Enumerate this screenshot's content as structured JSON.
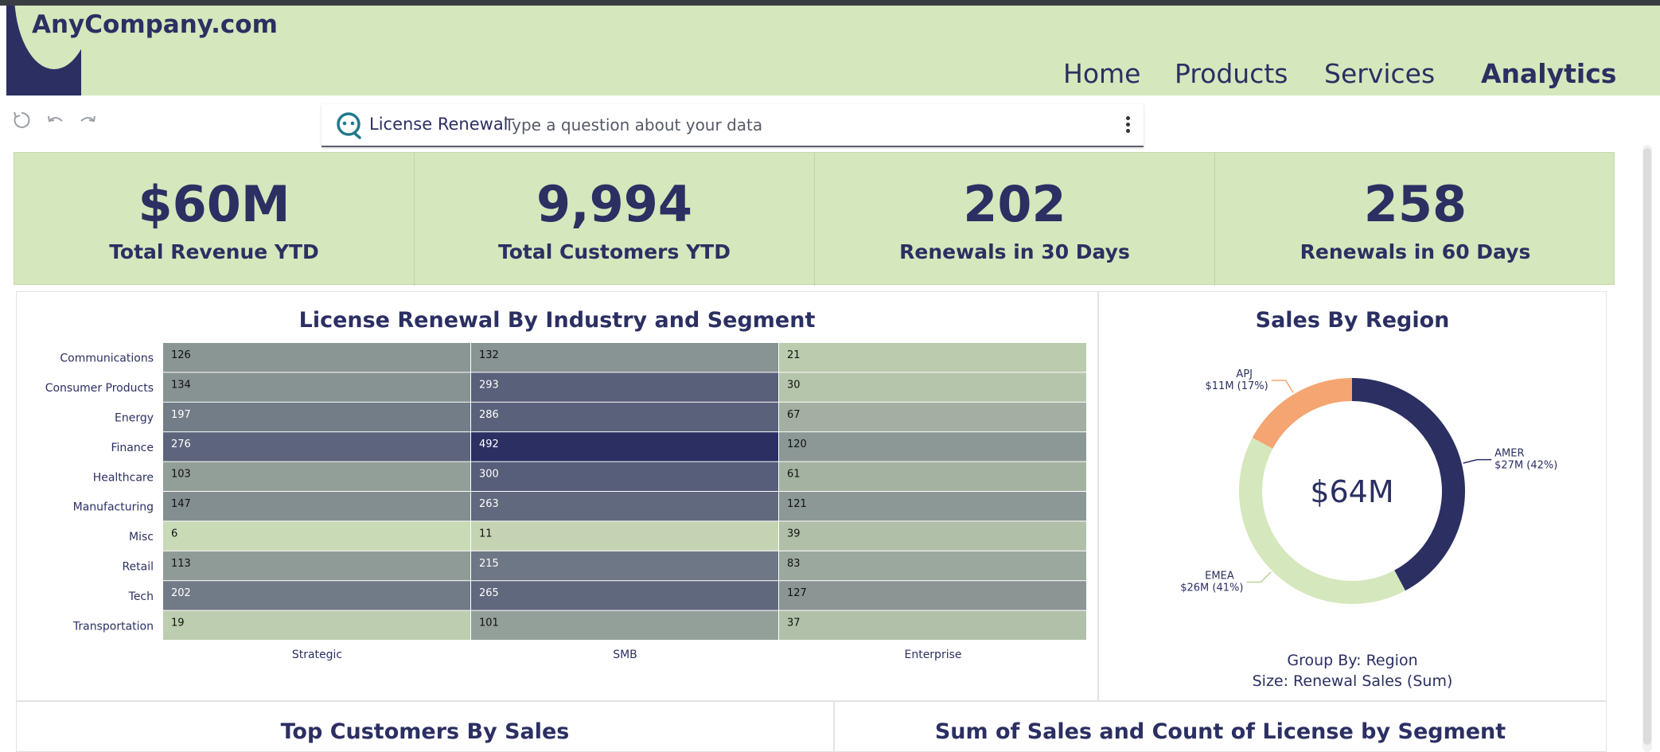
{
  "brand": {
    "logo_text": "AnyCompany.com"
  },
  "nav": {
    "items": [
      "Home",
      "Products",
      "Services",
      "Analytics"
    ],
    "active": "Analytics"
  },
  "toolbar": {
    "reset_icon": "reset-icon",
    "undo_icon": "undo-icon",
    "redo_icon": "redo-icon"
  },
  "qbar": {
    "topic": "License Renewal",
    "placeholder": "Type a question about your data"
  },
  "kpis": [
    {
      "value": "$60M",
      "label": "Total Revenue YTD"
    },
    {
      "value": "9,994",
      "label": "Total Customers YTD"
    },
    {
      "value": "202",
      "label": "Renewals in 30 Days"
    },
    {
      "value": "258",
      "label": "Renewals in 60 Days"
    }
  ],
  "heatmap": {
    "title": "License Renewal By Industry and Segment",
    "chart_data": {
      "type": "heatmap",
      "rows": [
        "Communications",
        "Consumer Products",
        "Energy",
        "Finance",
        "Healthcare",
        "Manufacturing",
        "Misc",
        "Retail",
        "Tech",
        "Transportation"
      ],
      "columns": [
        "Strategic",
        "SMB",
        "Enterprise"
      ],
      "values": [
        [
          126,
          132,
          21
        ],
        [
          134,
          293,
          30
        ],
        [
          197,
          286,
          67
        ],
        [
          276,
          492,
          120
        ],
        [
          103,
          300,
          61
        ],
        [
          147,
          263,
          121
        ],
        [
          6,
          11,
          39
        ],
        [
          113,
          215,
          83
        ],
        [
          202,
          265,
          127
        ],
        [
          19,
          101,
          37
        ]
      ],
      "color_low": "#d5e7bc",
      "color_high": "#2b2f62"
    }
  },
  "donut": {
    "title": "Sales By Region",
    "center_label": "$64M",
    "chart_data": {
      "type": "pie",
      "slices": [
        {
          "name": "AMER",
          "label": "$27M (42%)",
          "value": 27,
          "percent": 42,
          "color": "#2b2f62"
        },
        {
          "name": "EMEA",
          "label": "$26M (41%)",
          "value": 26,
          "percent": 41,
          "color": "#d5e7bc"
        },
        {
          "name": "APJ",
          "label": "$11M (17%)",
          "value": 11,
          "percent": 17,
          "color": "#f5a572"
        }
      ]
    },
    "group_by": "Group By: Region",
    "size": "Size: Renewal Sales (Sum)"
  },
  "bottom_panels": {
    "left_title": "Top Customers By Sales",
    "right_title": "Sum of Sales and Count of License by Segment"
  }
}
